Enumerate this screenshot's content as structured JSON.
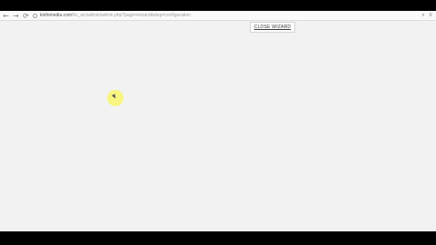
{
  "browser": {
    "url_host": "kinfomedia.com",
    "url_path": "/hc_wc/admin/admin.php?page=wizard&step=configuration"
  },
  "wizard": {
    "close_label": "CLOSE WIZARD"
  },
  "icons": {
    "back": "←",
    "forward": "→",
    "reload": "⟳",
    "search": "⌕",
    "menu": "≡"
  }
}
